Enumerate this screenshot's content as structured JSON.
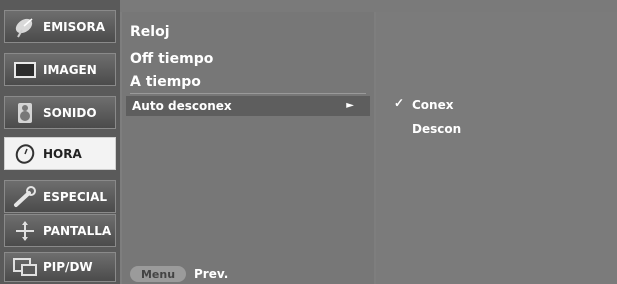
{
  "categories": [
    {
      "label": "EMISORA",
      "icon": "satellite-dish-icon",
      "active": false
    },
    {
      "label": "IMAGEN",
      "icon": "monitor-icon",
      "active": false
    },
    {
      "label": "SONIDO",
      "icon": "speaker-icon",
      "active": false
    },
    {
      "label": "HORA",
      "icon": "clock-icon",
      "active": true
    },
    {
      "label": "ESPECIAL",
      "icon": "wrench-icon",
      "active": false
    },
    {
      "label": "PANTALLA",
      "icon": "move-arrows-icon",
      "active": false
    },
    {
      "label": "PIP/DW",
      "icon": "picture-in-picture-icon",
      "active": false
    }
  ],
  "submenu": {
    "items": [
      {
        "label": "Reloj"
      },
      {
        "label": "Off tiempo"
      },
      {
        "label": "A tiempo"
      },
      {
        "label": "Auto desconex",
        "selected": true,
        "arrow": "►"
      }
    ]
  },
  "options": {
    "check_mark": "✓",
    "items": [
      {
        "label": "Conex",
        "checked": true
      },
      {
        "label": "Descon",
        "checked": false
      }
    ]
  },
  "footer": {
    "menu_button": "Menu",
    "prev_label": "Prev."
  },
  "colors": {
    "background": "#7e7e7e",
    "active_category": "#f3f3f3",
    "text": "#ffffff"
  }
}
